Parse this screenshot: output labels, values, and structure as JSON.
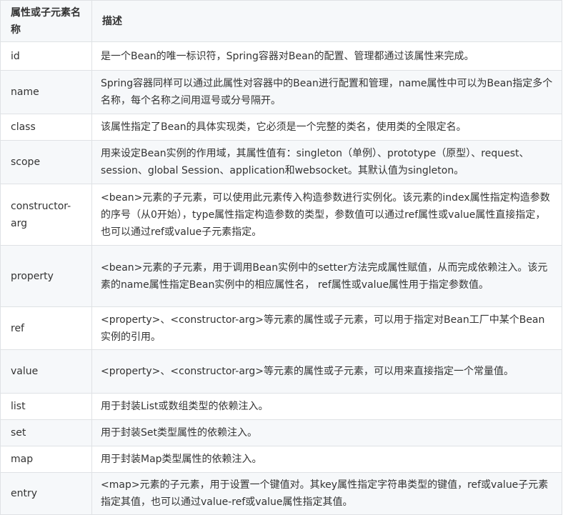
{
  "table": {
    "headers": [
      "属性或子元素名称",
      "描述"
    ],
    "rows": [
      {
        "name": "id",
        "desc": "是一个Bean的唯一标识符，Spring容器对Bean的配置、管理都通过该属性来完成。"
      },
      {
        "name": "name",
        "desc": "Spring容器同样可以通过此属性对容器中的Bean进行配置和管理，name属性中可以为Bean指定多个名称，每个名称之间用逗号或分号隔开。"
      },
      {
        "name": "class",
        "desc": "该属性指定了Bean的具体实现类，它必须是一个完整的类名，使用类的全限定名。"
      },
      {
        "name": "scope",
        "desc": "用来设定Bean实例的作用域，其属性值有：singleton（单例）、prototype（原型）、request、session、global Session、application和websocket。其默认值为singleton。"
      },
      {
        "name": "constructor-arg",
        "desc": "<bean>元素的子元素，可以使用此元素传入构造参数进行实例化。该元素的index属性指定构造参数的序号（从0开始），type属性指定构造参数的类型，参数值可以通过ref属性或value属性直接指定，也可以通过ref或value子元素指定。"
      },
      {
        "name": "property",
        "desc": "<bean>元素的子元素，用于调用Bean实例中的setter方法完成属性赋值，从而完成依赖注入。该元素的name属性指定Bean实例中的相应属性名， ref属性或value属性用于指定参数值。"
      },
      {
        "name": "ref",
        "desc": "<property>、<constructor-arg>等元素的属性或子元素，可以用于指定对Bean工厂中某个Bean实例的引用。"
      },
      {
        "name": "value",
        "desc": "<property>、<constructor-arg>等元素的属性或子元素，可以用来直接指定一个常量值。"
      },
      {
        "name": "list",
        "desc": "用于封装List或数组类型的依赖注入。"
      },
      {
        "name": "set",
        "desc": "用于封装Set类型属性的依赖注入。"
      },
      {
        "name": "map",
        "desc": "用于封装Map类型属性的依赖注入。"
      },
      {
        "name": "entry",
        "desc": "<map>元素的子元素，用于设置一个键值对。其key属性指定字符串类型的键值，ref或value子元素指定其值，也可以通过value-ref或value属性指定其值。"
      }
    ]
  }
}
